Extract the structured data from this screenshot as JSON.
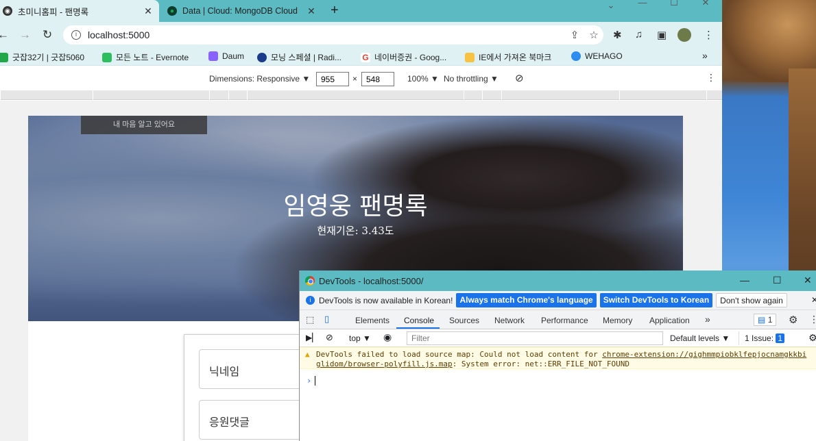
{
  "browser": {
    "tabs": [
      {
        "title": "초미니홈피 - 팬명록",
        "active": true
      },
      {
        "title": "Data | Cloud: MongoDB Cloud",
        "active": false
      }
    ],
    "new_tab_label": "+",
    "close_label": "✕",
    "url": "localhost:5000",
    "bookmarks": [
      {
        "label": "긋잡32기 | 긋잡5060",
        "color": "#22a84a"
      },
      {
        "label": "모든 노트 - Evernote",
        "color": "#2dbe60"
      },
      {
        "label": "Daum",
        "color": "#8a63ff"
      },
      {
        "label": "모닝 스페셜 | Radi...",
        "color": "#1b3c8a"
      },
      {
        "label": "네이버증권 - Goog...",
        "color": "#ea4335"
      },
      {
        "label": "IE에서 가져온 북마크",
        "color": "#f6c343"
      },
      {
        "label": "WEHAGO",
        "color": "#2d8cf0"
      }
    ],
    "bookmarks_more": "»"
  },
  "devbar": {
    "dimensions_label": "Dimensions: Responsive ▼",
    "width_value": "955",
    "times": "×",
    "height_value": "548",
    "zoom_label": "100% ▼",
    "throttle_label": "No throttling ▼"
  },
  "page": {
    "hero_caption": "내 마음 알고 있어요",
    "title": "임영웅 팬명록",
    "weather": "현재기온: 3.43도",
    "nickname_placeholder": "닉네임",
    "comment_placeholder": "응원댓글"
  },
  "devtools": {
    "window_title": "DevTools - localhost:5000/",
    "info_text": "DevTools is now available in Korean!",
    "btn_match": "Always match Chrome's language",
    "btn_switch": "Switch DevTools to Korean",
    "btn_dont": "Don't show again",
    "tabs": [
      "Elements",
      "Console",
      "Sources",
      "Network",
      "Performance",
      "Memory",
      "Application"
    ],
    "more_tabs": "»",
    "issues_badge": "1",
    "context": "top ▼",
    "filter_placeholder": "Filter",
    "levels": "Default levels ▼",
    "issues_count": "1 Issue:",
    "issues_count_badge": "1",
    "warning_prefix": "DevTools failed to load source map: Could not load content for ",
    "warning_link_1": "chrome-extension://gighmmpiobklfepjocnamgkkbi",
    "warning_link_2": "glidom/browser-polyfill.js.map",
    "warning_suffix": ": System error: net::ERR_FILE_NOT_FOUND",
    "prompt": "›"
  }
}
